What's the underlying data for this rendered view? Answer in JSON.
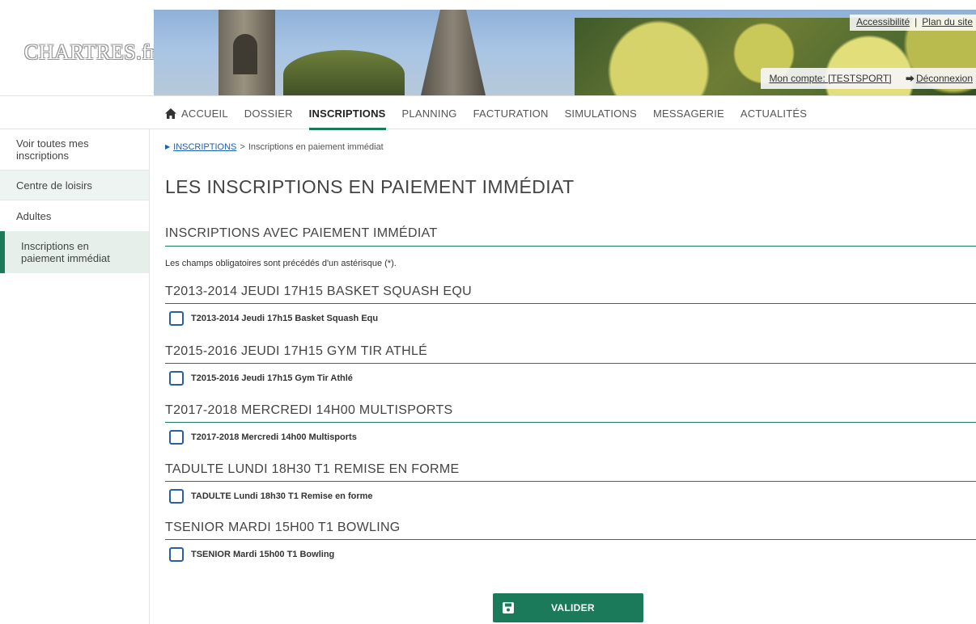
{
  "header": {
    "logo": "CHARTRES.fr",
    "top_links": [
      "Accessibilité",
      "Plan du site"
    ],
    "account_label": "Mon compte: [TESTSPORT]",
    "logout_label": "Déconnexion"
  },
  "nav": {
    "home": "ACCUEIL",
    "items": [
      "DOSSIER",
      "INSCRIPTIONS",
      "PLANNING",
      "FACTURATION",
      "SIMULATIONS",
      "MESSAGERIE",
      "ACTUALITÉS"
    ],
    "active": "INSCRIPTIONS"
  },
  "sidebar": {
    "items": [
      "Voir toutes mes inscriptions",
      "Centre de loisirs",
      "Adultes",
      "Inscriptions en paiement immédiat"
    ],
    "active": "Inscriptions en paiement immédiat"
  },
  "main": {
    "breadcrumb": {
      "link": "INSCRIPTIONS",
      "separator": ">",
      "current": "Inscriptions en paiement immédiat"
    },
    "page_title": "LES INSCRIPTIONS EN PAIEMENT IMMÉDIAT",
    "section_title": "INSCRIPTIONS AVEC PAIEMENT IMMÉDIAT",
    "required_note": "Les champs obligatoires sont précédés d'un astérisque (*).",
    "groups": [
      {
        "title": "T2013-2014 JEUDI 17H15 BASKET SQUASH EQU",
        "option": "T2013-2014 Jeudi 17h15 Basket Squash Equ",
        "checked": false
      },
      {
        "title": "T2015-2016 JEUDI 17H15 GYM TIR ATHLÉ",
        "option": "T2015-2016 Jeudi 17h15 Gym Tir Athlé",
        "checked": false
      },
      {
        "title": "T2017-2018 MERCREDI 14H00 MULTISPORTS",
        "option": "T2017-2018 Mercredi 14h00 Multisports",
        "checked": false
      },
      {
        "title": "TADULTE LUNDI 18H30 T1 REMISE EN FORME",
        "option": "TADULTE Lundi 18h30 T1 Remise en forme",
        "checked": false
      },
      {
        "title": "TSENIOR MARDI 15H00 T1 BOWLING",
        "option": "TSENIOR Mardi 15h00 T1 Bowling",
        "checked": false
      }
    ],
    "submit_label": "VALIDER"
  },
  "colors": {
    "accent": "#1a7a5a",
    "link": "#1a5fb4",
    "checkbox_border": "#2a5fa8"
  }
}
